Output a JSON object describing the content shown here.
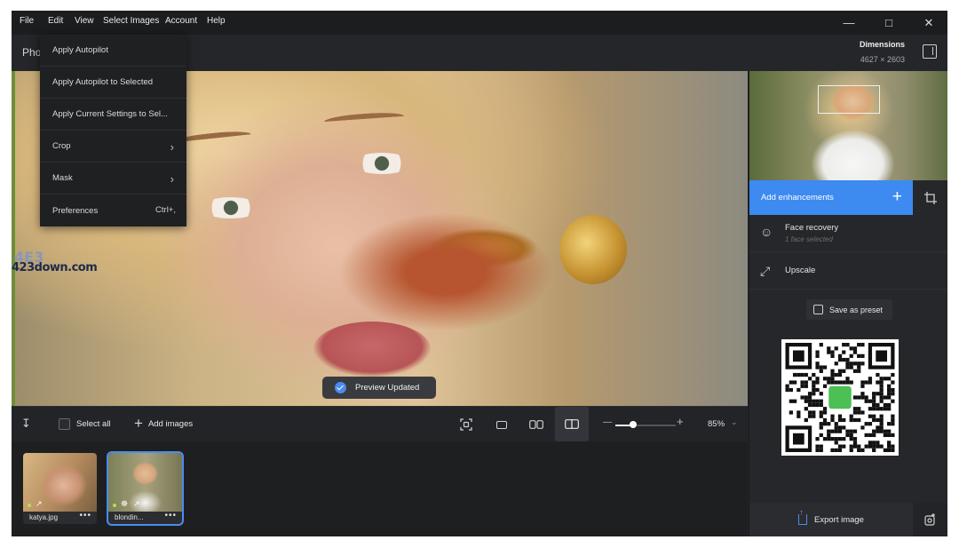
{
  "menu": [
    "File",
    "Edit",
    "View",
    "Select Images",
    "Account",
    "Help"
  ],
  "window_controls": {
    "minimize": "—",
    "maximize": "□",
    "close": "✕"
  },
  "header": {
    "app_label": "Pho",
    "dimensions_label": "Dimensions",
    "dimensions_value": "4627 × 2603"
  },
  "dropdown": {
    "items": [
      {
        "label": "Apply Autopilot"
      },
      {
        "label": "Apply Autopilot to Selected"
      },
      {
        "label": "Apply Current Settings to Sel..."
      },
      {
        "label": "Crop",
        "chevron": "›"
      },
      {
        "label": "Mask",
        "chevron": "›"
      },
      {
        "label": "Preferences",
        "shortcut": "Ctrl+,"
      }
    ]
  },
  "toast": {
    "text": "Preview Updated"
  },
  "watermark": {
    "top": "4E3",
    "bottom": "423down.com"
  },
  "toolbar": {
    "select_all": "Select all",
    "add_images": "Add images",
    "zoom_value": "85%",
    "zoom_level": 0.3
  },
  "filmstrip": [
    {
      "name": "katya.jpg"
    },
    {
      "name": "blondin..."
    }
  ],
  "right_panel": {
    "add_enhancements": "Add enhancements",
    "enhancements": [
      {
        "title": "Face recovery",
        "subtitle": "1 face selected"
      },
      {
        "title": "Upscale",
        "subtitle": ""
      }
    ],
    "save_preset": "Save as preset",
    "export": "Export image"
  },
  "colors": {
    "accent": "#3d8af0",
    "background": "#232427",
    "menubar": "#1c1d1f"
  }
}
